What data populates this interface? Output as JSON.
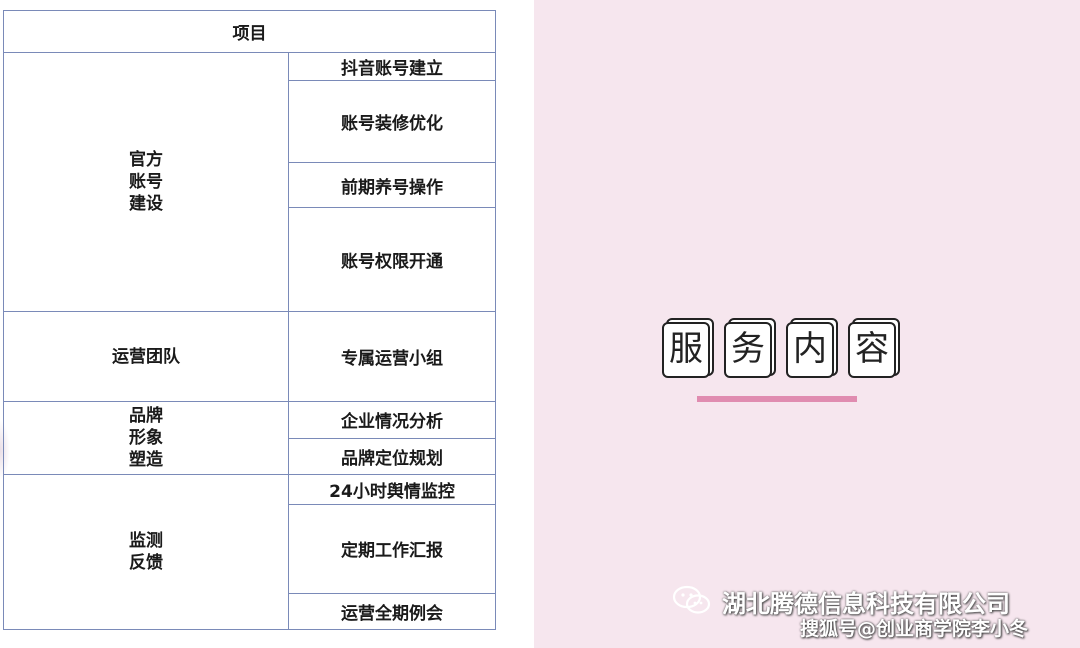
{
  "table": {
    "header": "项目",
    "sections": [
      {
        "category": "官方\n账号\n建设",
        "items": [
          "抖音账号建立",
          "账号装修优化",
          "前期养号操作",
          "账号权限开通"
        ]
      },
      {
        "category": "运营团队",
        "items": [
          "专属运营小组"
        ]
      },
      {
        "category": "品牌\n形象\n塑造",
        "items": [
          "企业情况分析",
          "品牌定位规划"
        ]
      },
      {
        "category": "监测\n反馈",
        "items": [
          "24小时舆情监控",
          "定期工作汇报",
          "运营全期例会"
        ]
      }
    ]
  },
  "title": {
    "chars": [
      "服",
      "务",
      "内",
      "容"
    ],
    "accent_color": "#e08cb0"
  },
  "footer": {
    "icon": "wechat-icon",
    "company": "湖北腾德信息科技有限公司",
    "watermark": "搜狐号@创业商学院李小冬"
  },
  "colors": {
    "right_bg": "#f6e6ee",
    "table_border": "#7a8ab8"
  }
}
